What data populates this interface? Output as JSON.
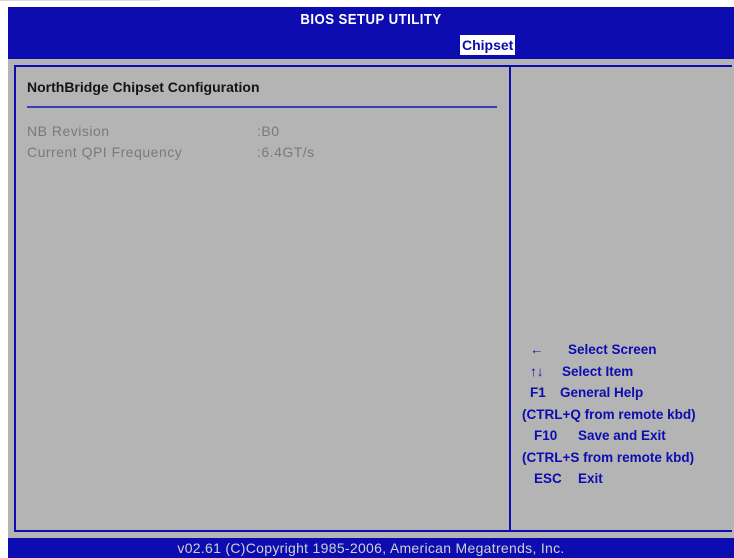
{
  "header": {
    "title": "BIOS SETUP UTILITY",
    "active_tab": "Chipset"
  },
  "main": {
    "section_title": "NorthBridge Chipset Configuration",
    "settings": [
      {
        "label": "NB Revision",
        "value": ":B0"
      },
      {
        "label": "Current QPI Frequency",
        "value": ":6.4GT/s"
      }
    ]
  },
  "help": {
    "items": [
      {
        "key": "←",
        "desc": "Select Screen"
      },
      {
        "key": "↑↓",
        "desc": "Select Item"
      },
      {
        "key": "F1",
        "desc": "General Help"
      },
      {
        "key": "",
        "desc": "(CTRL+Q from remote kbd)"
      },
      {
        "key": "F10",
        "desc": "Save and Exit"
      },
      {
        "key": "",
        "desc": "(CTRL+S from remote kbd)"
      },
      {
        "key": "ESC",
        "desc": "Exit"
      }
    ]
  },
  "footer": {
    "text": "v02.61 (C)Copyright 1985-2006, American Megatrends, Inc."
  },
  "colors": {
    "bios_blue": "#0c0cb0",
    "panel_gray": "#b4b4b4",
    "disabled_text": "#7a7a7a"
  }
}
